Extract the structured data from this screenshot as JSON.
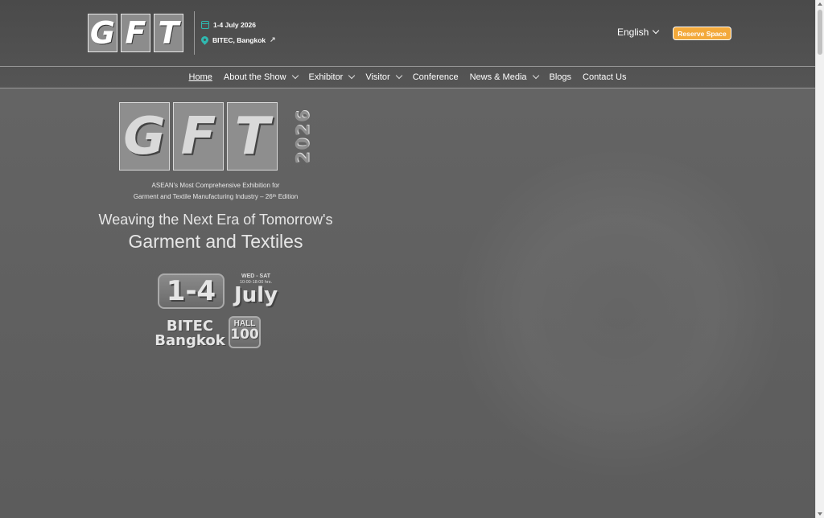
{
  "header": {
    "logo_letters": [
      "G",
      "F",
      "T"
    ],
    "date": "1-4 July 2026",
    "venue": "BITEC, Bangkok",
    "language": "English",
    "reserve_label": "Reserve Space"
  },
  "nav": {
    "items": [
      {
        "label": "Home",
        "dropdown": false,
        "active": true
      },
      {
        "label": "About the Show",
        "dropdown": true
      },
      {
        "label": "Exhibitor",
        "dropdown": true
      },
      {
        "label": "Visitor",
        "dropdown": true
      },
      {
        "label": "Conference",
        "dropdown": false
      },
      {
        "label": "News & Media",
        "dropdown": true
      },
      {
        "label": "Blogs",
        "dropdown": false
      },
      {
        "label": "Contact Us",
        "dropdown": false
      }
    ]
  },
  "hero": {
    "logo_letters": [
      "G",
      "F",
      "T"
    ],
    "year": "2026",
    "tagline_1": "ASEAN's Most Comprehensive Exhibition for",
    "tagline_2": "Garment and Textile Manufacturing Industry – 26ᵗʰ Edition",
    "headline_1": "Weaving the Next Era of Tomorrow's",
    "headline_2": "Garment and Textiles",
    "dates": "1-4",
    "days": "WED - SAT",
    "hours": "10:00-18:00 hrs.",
    "month": "July",
    "venue_1": "BITEC",
    "venue_2": "Bangkok",
    "hall_label": "HALL",
    "hall_number": "100"
  }
}
